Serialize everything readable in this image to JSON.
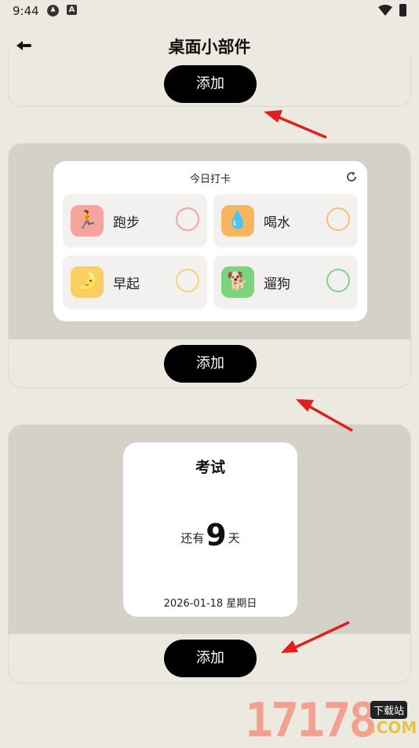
{
  "status_bar": {
    "time": "9:44",
    "icon2_letter": "A"
  },
  "header": {
    "title": "桌面小部件"
  },
  "cards": [
    {
      "add_label": "添加"
    },
    {
      "add_label": "添加"
    },
    {
      "add_label": "添加"
    }
  ],
  "checkin": {
    "title": "今日打卡",
    "habits": [
      {
        "emoji": "🏃",
        "label": "跑步",
        "color": "#f4a59a",
        "bg": "#f6a59d"
      },
      {
        "emoji": "💧",
        "label": "喝水",
        "color": "#f5c073",
        "bg": "#f7b65d"
      },
      {
        "emoji": "🌛",
        "label": "早起",
        "color": "#f6d27a",
        "bg": "#f9cf62"
      },
      {
        "emoji": "🐕",
        "label": "遛狗",
        "color": "#7ed28c",
        "bg": "#7dd37c"
      }
    ]
  },
  "countdown": {
    "title": "考试",
    "prefix": "还有",
    "days": "9",
    "unit": "天",
    "date": "2026-01-18 星期日"
  },
  "watermark": {
    "digits": "17178",
    "badge": "下载站",
    "suffix": ".COM"
  },
  "colors": {
    "background": "#ece9e1",
    "preview": "#d4d1c9",
    "button": "#000000",
    "arrow": "#e02020"
  }
}
